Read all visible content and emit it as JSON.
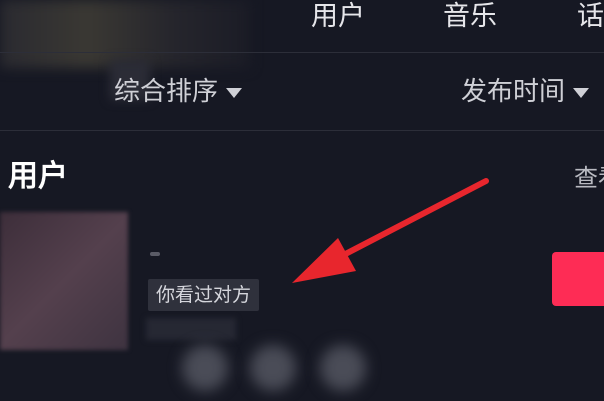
{
  "tabs": [
    {
      "label": "用户"
    },
    {
      "label": "音乐"
    },
    {
      "label": "话"
    }
  ],
  "filters": {
    "sort_label": "综合排序",
    "time_label": "发布时间"
  },
  "section": {
    "title": "用户",
    "view_all": "查看"
  },
  "user_card": {
    "badge": "你看过对方"
  },
  "colors": {
    "background": "#161823",
    "accent": "#fe2c55",
    "annotation_arrow": "#e8262d"
  },
  "icons": {
    "sort_caret": "caret-down-icon",
    "time_caret": "caret-down-icon",
    "annotation": "red-arrow-icon"
  }
}
